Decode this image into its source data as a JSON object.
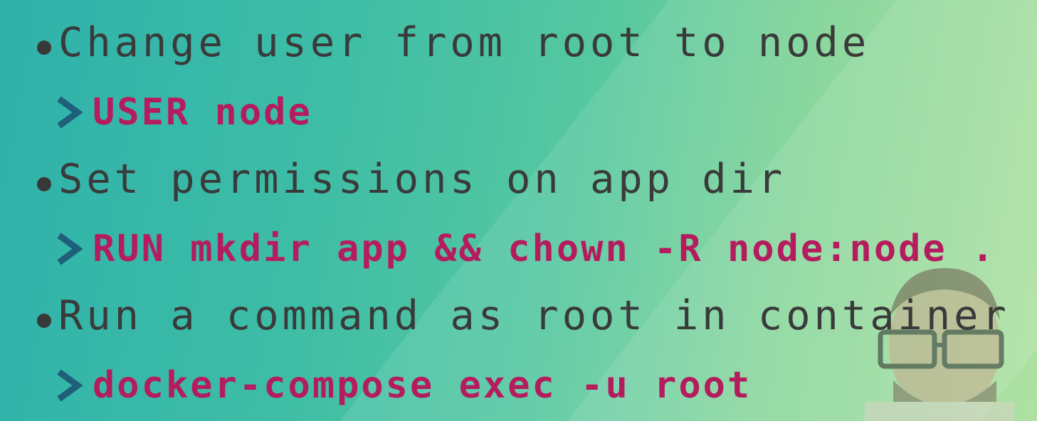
{
  "slide": {
    "items": [
      {
        "bullet": "Change user from root to node",
        "command": "USER node"
      },
      {
        "bullet": "Set permissions on app dir",
        "command": "RUN mkdir app && chown -R node:node ."
      },
      {
        "bullet": "Run a command as root in container",
        "command": "docker-compose exec -u root"
      }
    ]
  },
  "colors": {
    "bullet_text": "#3a3a3a",
    "command_text": "#b51c5e",
    "chevron": "#1f5f7a",
    "background_start": "#2fb1ab",
    "background_end": "#a6de98"
  },
  "icons": {
    "bullet": "filled-circle",
    "command_prefix": "chevron-right-icon"
  }
}
